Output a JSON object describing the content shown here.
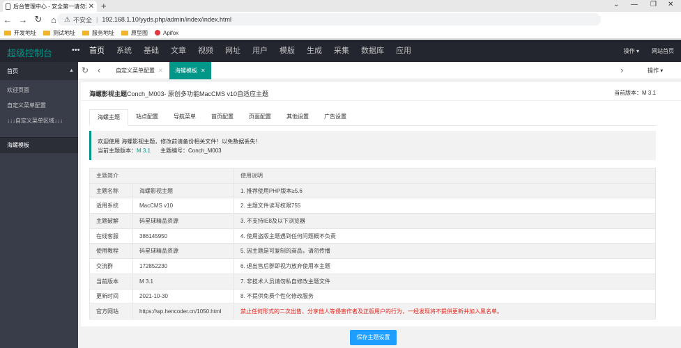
{
  "browser": {
    "tab_title": "后台管理中心 - 安全第一请勿泄露",
    "security": "不安全",
    "url": "192.168.1.10/yyds.php/admin/index/index.html",
    "bookmarks": [
      {
        "label": "开发地址",
        "icon": "folder-icon"
      },
      {
        "label": "测试地址",
        "icon": "folder-icon"
      },
      {
        "label": "服务地址",
        "icon": "folder-icon"
      },
      {
        "label": "原型图",
        "icon": "folder-icon"
      },
      {
        "label": "Apifox",
        "icon": "apifox-icon"
      }
    ]
  },
  "header": {
    "logo": "超级控制台",
    "menu": [
      "首页",
      "系统",
      "基础",
      "文章",
      "视频",
      "网址",
      "用户",
      "模版",
      "生成",
      "采集",
      "数据库",
      "应用"
    ],
    "active_menu": "首页",
    "operate": "操作",
    "site_home": "网站首页"
  },
  "sidebar": {
    "head": "首页",
    "items": [
      "欢迎页面",
      "自定义菜单配置",
      "↓↓↓自定义菜单区域↓↓↓"
    ],
    "active_item": "海螺模板"
  },
  "tabstrip": {
    "tabs": [
      {
        "label": "自定义菜单配置",
        "active": false
      },
      {
        "label": "海螺模板",
        "active": true
      }
    ],
    "operate": "操作"
  },
  "page": {
    "title_bold": "海螺影视主题",
    "title_rest": "Conch_M003- 原创多功能MacCMS v10自适应主题",
    "version_label": "当前版本：M 3.1",
    "tabs": [
      "海螺主题",
      "站点配置",
      "导航菜单",
      "首页配置",
      "页面配置",
      "其他设置",
      "广告设置"
    ],
    "notice_line1": "欢迎使用 海螺影视主题，修改前请备份相关文件！以免数据丢失！",
    "notice_ver_label": "当前主题版本：",
    "notice_ver": "M 3.1",
    "notice_code_label": "主题编号：",
    "notice_code": "Conch_M003",
    "table_head": [
      "主题简介",
      "使用说明"
    ],
    "table_rows": [
      {
        "k": "主题名称",
        "v": "海螺影视主题",
        "n": "1. 推荐使用PHP版本≥5.6"
      },
      {
        "k": "适用系统",
        "v": "MacCMS v10",
        "n": "2. 主题文件读写权限755"
      },
      {
        "k": "主题破解",
        "v": "码星球精品资源",
        "n": "3. 不支持IE8及以下浏览器"
      },
      {
        "k": "在线客服",
        "v": "386145950",
        "n": "4. 使用盗版主题遇到任何问题概不负责"
      },
      {
        "k": "使用教程",
        "v": "码星球精品资源",
        "n": "5. 因主题是可复制的商品，请勿传播"
      },
      {
        "k": "交流群",
        "v": "172852230",
        "n": "6. 退出售后群即视为放弃使用本主题"
      },
      {
        "k": "当前版本",
        "v": "M 3.1",
        "n": "7. 非技术人员请勿私自修改主题文件"
      },
      {
        "k": "更新时间",
        "v": "2021-10-30",
        "n": "8. 不提供免费个性化修改服务"
      },
      {
        "k": "官方网站",
        "v": "https://wp.hencoder.cn/1050.html",
        "n": "禁止任何形式的二次出售、分享他人等侵害作者及正版用户的行为，一经发现将不提供更新并加入黑名单。"
      }
    ],
    "save_button": "保存主题设置"
  },
  "colors": {
    "accent": "#009688",
    "nav_bg": "#23262e",
    "sidebar_bg": "#393d49",
    "button": "#1e9fff",
    "warning_text": "#e1251b"
  }
}
